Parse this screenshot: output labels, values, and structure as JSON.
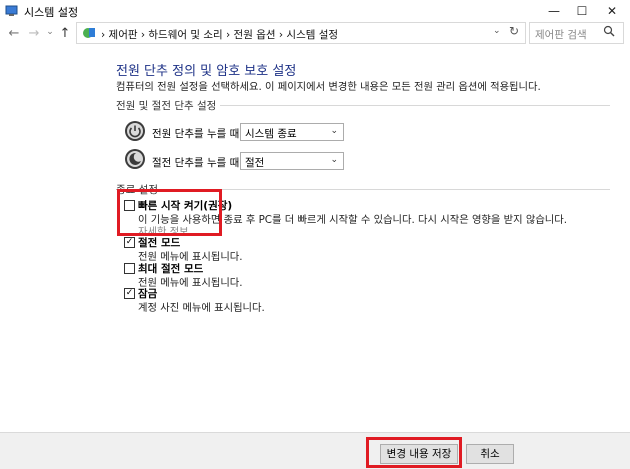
{
  "window": {
    "title": "시스템 설정",
    "minimize_glyph": "—",
    "maximize_glyph": "☐",
    "close_glyph": "✕"
  },
  "nav": {
    "back_glyph": "←",
    "forward_glyph": "→",
    "recent_glyph": "⌄",
    "up_glyph": "↑",
    "dropdown_glyph": "⌄",
    "refresh_glyph": "↻"
  },
  "address": {
    "breadcrumb": "›  제어판  ›  하드웨어 및 소리  ›  전원 옵션  ›  시스템 설정"
  },
  "search": {
    "placeholder": "제어판 검색"
  },
  "page": {
    "title": "전원 단추 정의 및 암호 보호 설정",
    "description": "컴퓨터의 전원 설정을 선택하세요. 이 페이지에서 변경한 내용은 모든 전원 관리 옵션에 적용됩니다."
  },
  "buttons_section": {
    "header": "전원 및 절전 단추 설정",
    "rows": [
      {
        "label": "전원 단추를 누를 때:",
        "value": "시스템 종료",
        "icon": "power-icon"
      },
      {
        "label": "절전 단추를 누를 때:",
        "value": "절전",
        "icon": "sleep-icon"
      }
    ]
  },
  "shutdown_section": {
    "header": "종료 설정",
    "fast_startup": {
      "label": "빠른 시작 켜기(권장)",
      "checked": false,
      "description": "이 기능을 사용하면 종료 후 PC를 더 빠르게 시작할 수 있습니다. 다시 시작은 영향을 받지 않습니다.",
      "link": "자세한 정보"
    },
    "options": [
      {
        "label": "절전 모드",
        "checked": true,
        "description": "전원 메뉴에 표시됩니다."
      },
      {
        "label": "최대 절전 모드",
        "checked": false,
        "description": "전원 메뉴에 표시됩니다."
      },
      {
        "label": "잠금",
        "checked": true,
        "description": "계정 사진 메뉴에 표시됩니다."
      }
    ]
  },
  "footer": {
    "save_label": "변경 내용 저장",
    "cancel_label": "취소"
  },
  "check_glyph": "✓",
  "colors": {
    "title_blue": "#1e3287",
    "highlight_red": "#e01b23"
  }
}
